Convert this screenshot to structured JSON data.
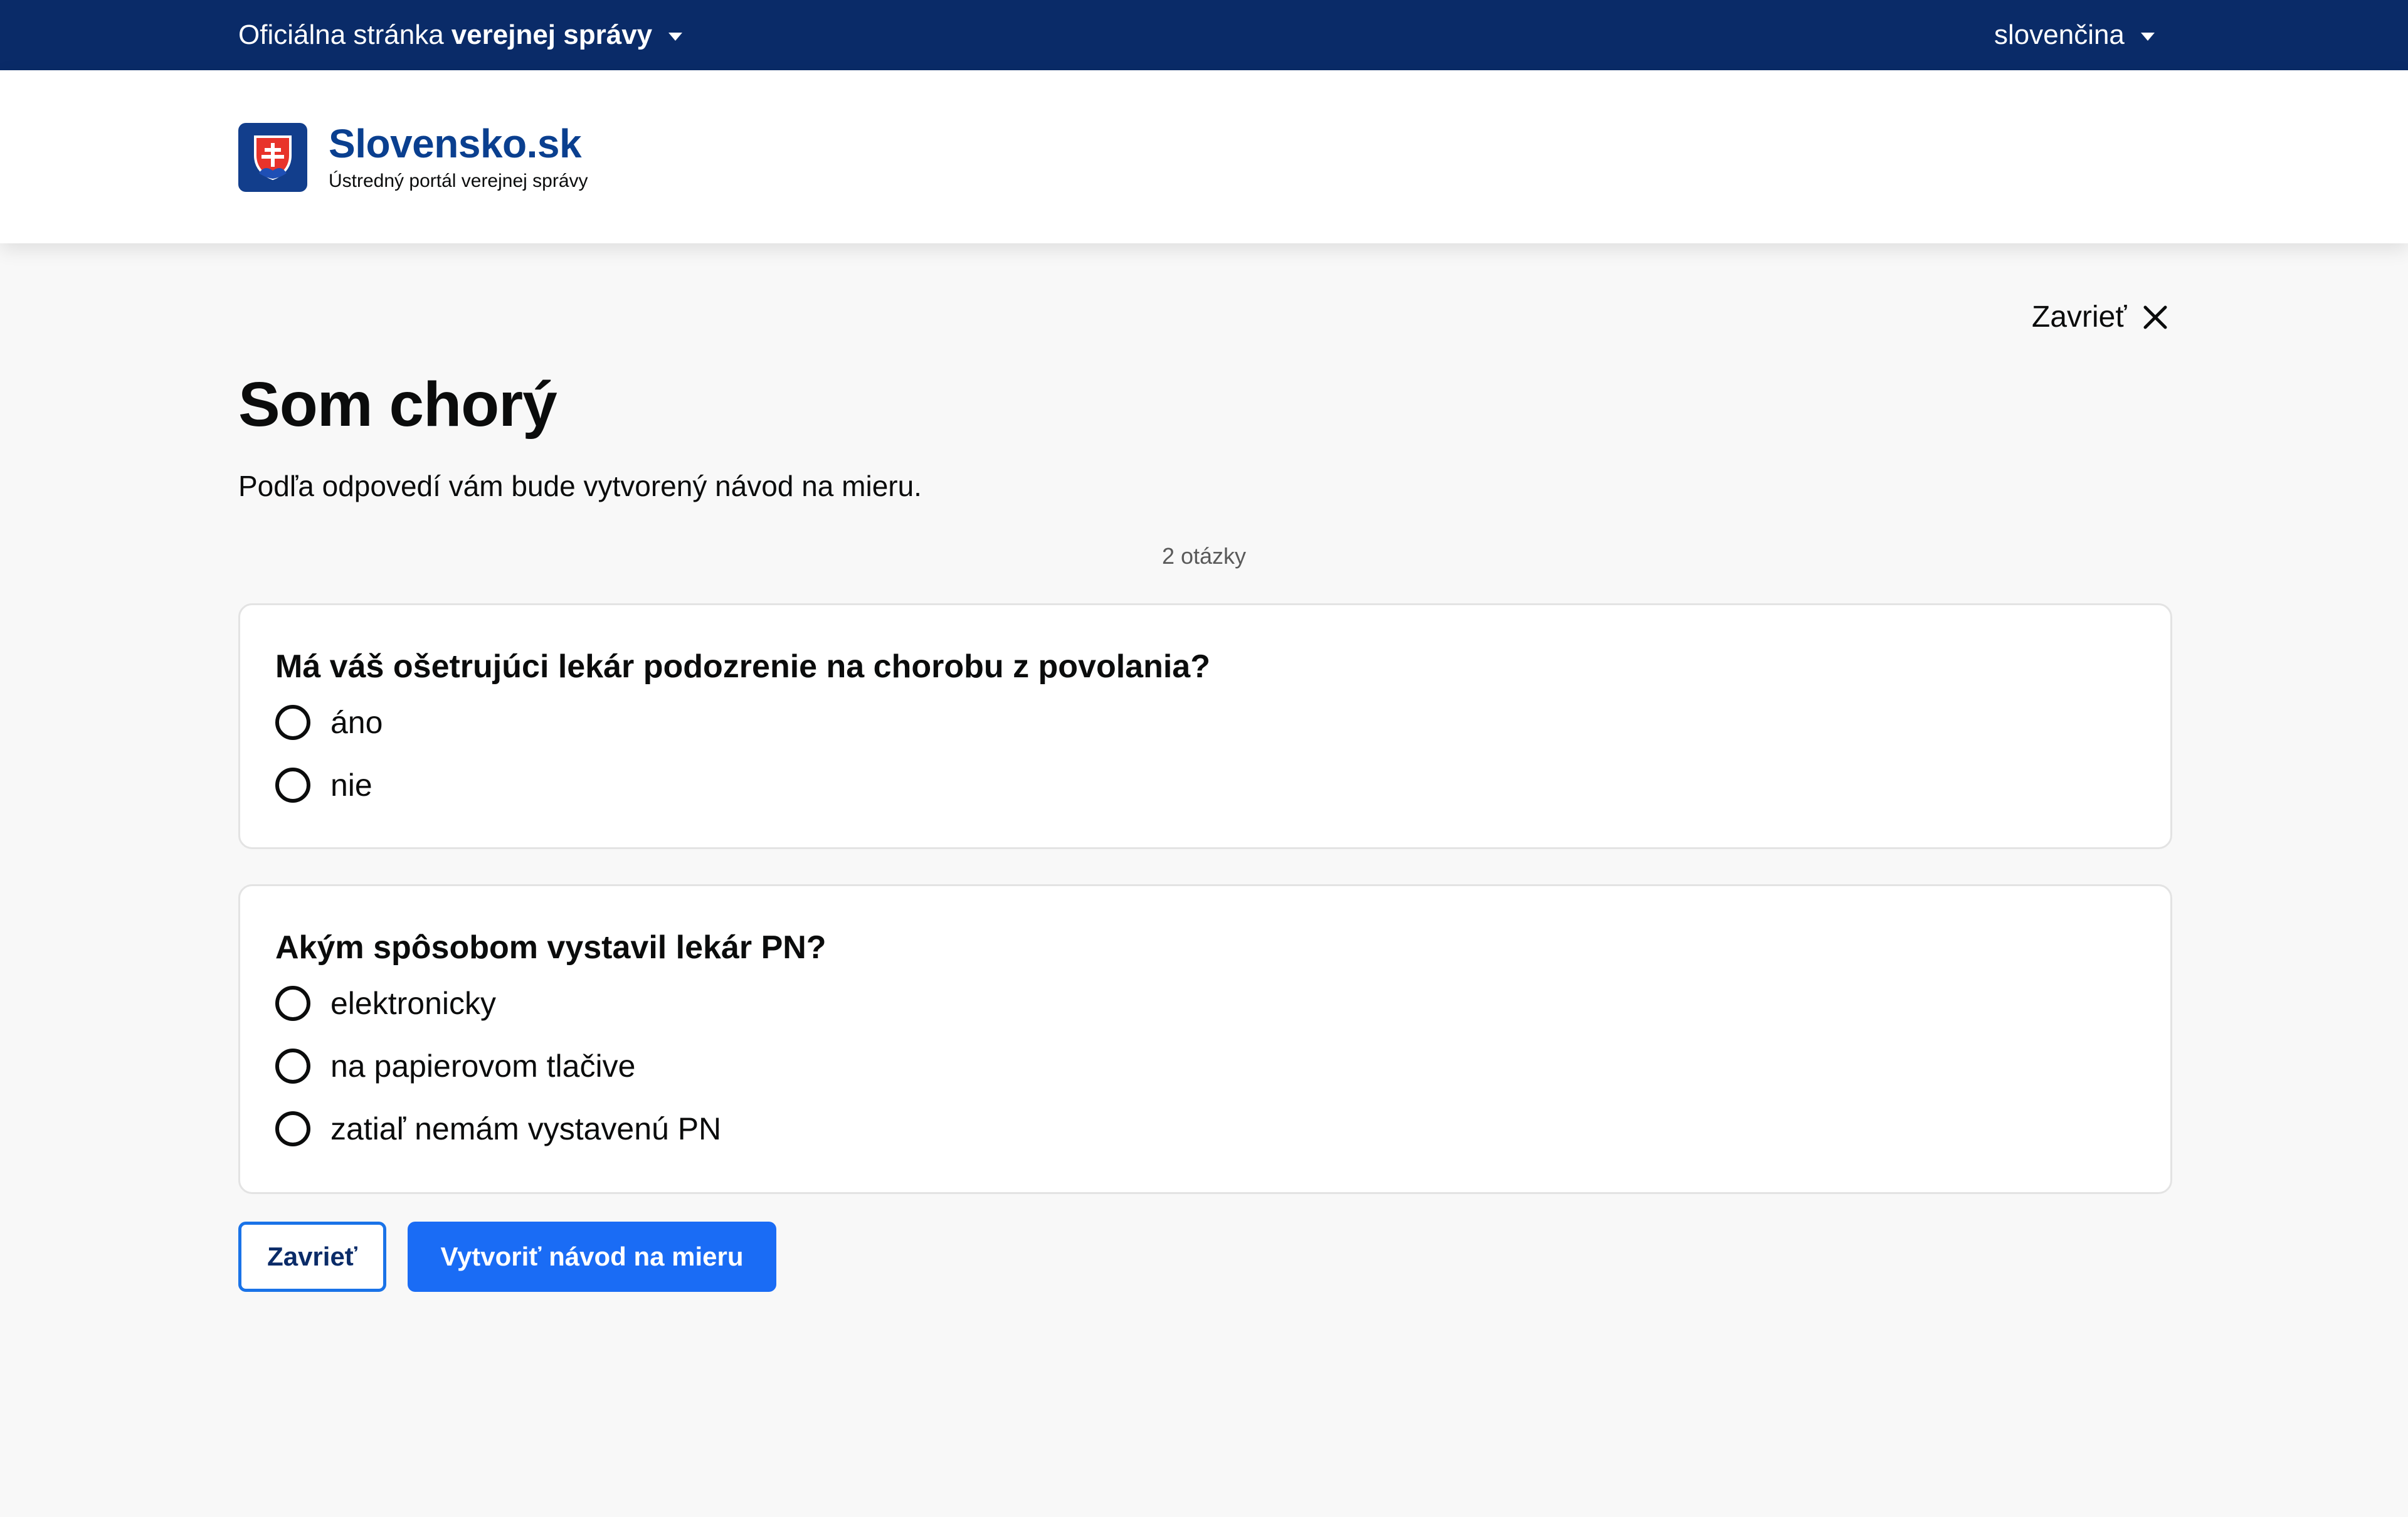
{
  "gov_bar": {
    "official_prefix": "Oficiálna stránka",
    "official_bold": "verejnej správy",
    "language": "slovenčina"
  },
  "header": {
    "site_name": "Slovensko.sk",
    "site_subtitle": "Ústredný portál verejnej správy"
  },
  "main": {
    "close_label": "Zavrieť",
    "title": "Som chorý",
    "lead": "Podľa odpovedí vám bude vytvorený návod na mieru.",
    "question_count": "2 otázky"
  },
  "questions": [
    {
      "text": "Má váš ošetrujúci lekár podozrenie na chorobu z povolania?",
      "options": [
        "áno",
        "nie"
      ]
    },
    {
      "text": "Akým spôsobom vystavil lekár PN?",
      "options": [
        "elektronicky",
        "na papierovom tlačive",
        "zatiaľ nemám vystavenú PN"
      ]
    }
  ],
  "actions": {
    "close": "Zavrieť",
    "create": "Vytvoriť návod na mieru"
  },
  "colors": {
    "gov_bar": "#0a2b68",
    "brand_text": "#0a3f8f",
    "primary_button": "#1a6cf5",
    "page_background": "#f8f8f8"
  },
  "icons": {
    "logo": "slovak-coat-of-arms-icon",
    "close": "close-icon",
    "dropdown": "chevron-down-icon",
    "radio": "radio-unchecked-icon"
  }
}
